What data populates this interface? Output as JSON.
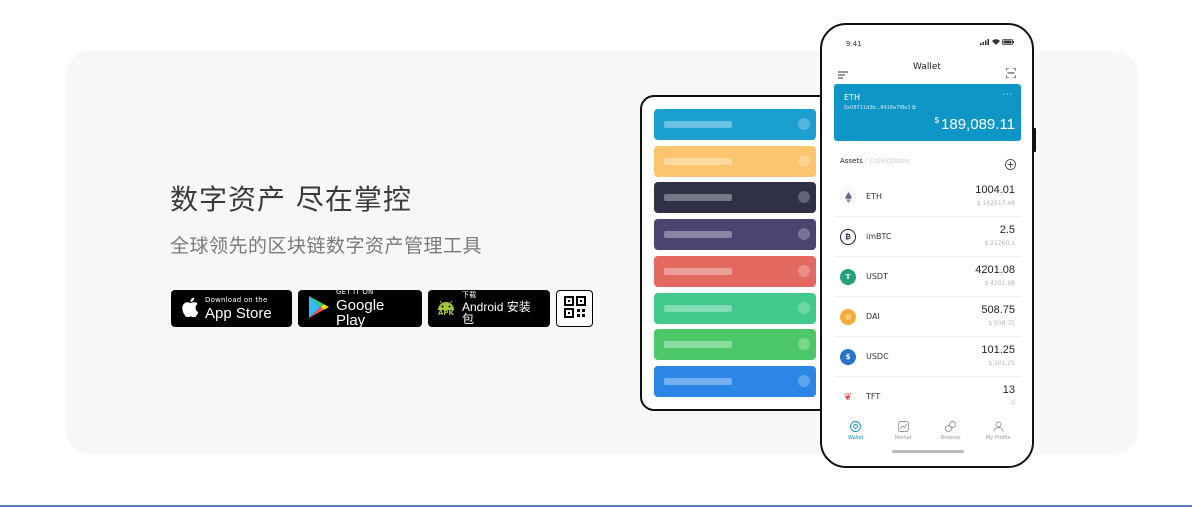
{
  "hero": {
    "title": "数字资产 尽在掌控",
    "subtitle": "全球领先的区块链数字资产管理工具"
  },
  "downloads": {
    "appstore": {
      "small": "Download on the",
      "big": "App Store"
    },
    "googleplay": {
      "small": "GET IT ON",
      "big": "Google Play"
    },
    "apk": {
      "small": "下载",
      "badge": "APK",
      "big": "Android 安装包"
    }
  },
  "cards": {
    "colors": [
      "#1a9fcf",
      "#fcc56d",
      "#2f3146",
      "#4a4470",
      "#e36961",
      "#40c98b",
      "#4cc86a",
      "#2b86e6"
    ]
  },
  "phone": {
    "time": "9:41",
    "nav_title": "Wallet",
    "eth_card": {
      "name": "ETH",
      "address": "0x08711d3b...8418a7f8e3",
      "more": "···",
      "currency": "$",
      "balance": "189,089.11",
      "color": "#0e97c6"
    },
    "tabs": {
      "active": "Assets",
      "separator": "/",
      "inactive": "Collectibles"
    },
    "assets": [
      {
        "symbol": "ETH",
        "amount": "1004.01",
        "value": "$ 162517.48",
        "color": "#ffffff",
        "icon": "eth-icon"
      },
      {
        "symbol": "imBTC",
        "amount": "2.5",
        "value": "$ 21760.1",
        "color": "#1b1b3a",
        "icon": "imbtc-icon"
      },
      {
        "symbol": "USDT",
        "amount": "4201.08",
        "value": "$ 4201.08",
        "color": "#26a17b",
        "icon": "usdt-icon"
      },
      {
        "symbol": "DAI",
        "amount": "508.75",
        "value": "$ 508.75",
        "color": "#f5ac37",
        "icon": "dai-icon"
      },
      {
        "symbol": "USDC",
        "amount": "101.25",
        "value": "$ 101.25",
        "color": "#2775ca",
        "icon": "usdc-icon"
      },
      {
        "symbol": "TFT",
        "amount": "13",
        "value": "0",
        "color": "#e24d4d",
        "icon": "tft-icon"
      }
    ],
    "bottom_nav": [
      {
        "label": "Wallet",
        "icon": "wallet-icon"
      },
      {
        "label": "Market",
        "icon": "market-icon"
      },
      {
        "label": "Browser",
        "icon": "browser-icon"
      },
      {
        "label": "My Profile",
        "icon": "profile-icon"
      }
    ]
  }
}
